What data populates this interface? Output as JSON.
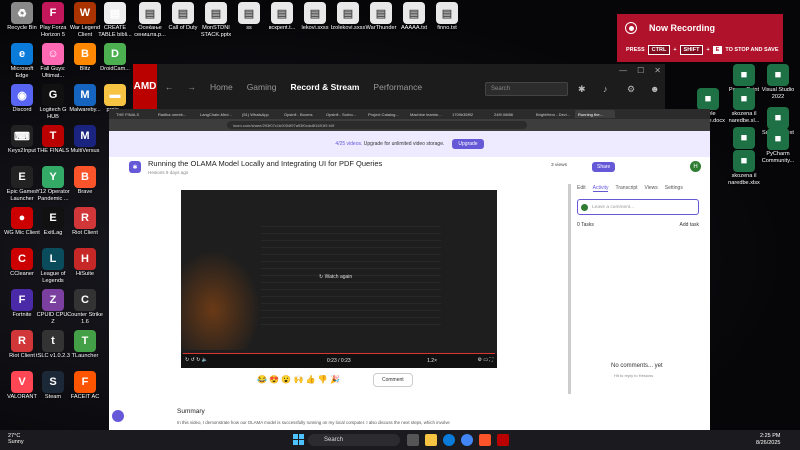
{
  "desktop_icons": [
    {
      "label": "Recycle Bin",
      "color": "#888",
      "glyph": "♻"
    },
    {
      "label": "Microsoft Edge",
      "color": "#0a7bd8",
      "glyph": "e"
    },
    {
      "label": "Discord",
      "color": "#5865f2",
      "glyph": "◉"
    },
    {
      "label": "Keys2Input",
      "color": "#222",
      "glyph": "⌨"
    },
    {
      "label": "Epic Games Launcher",
      "color": "#222",
      "glyph": "E"
    },
    {
      "label": "WG Mic Client",
      "color": "#c00",
      "glyph": "●"
    },
    {
      "label": "CCleaner",
      "color": "#c00",
      "glyph": "C"
    },
    {
      "label": "Fortnite",
      "color": "#4b2aa8",
      "glyph": "F"
    },
    {
      "label": "Riot Client",
      "color": "#d13639",
      "glyph": "R"
    },
    {
      "label": "VALORANT",
      "color": "#ff4655",
      "glyph": "V"
    },
    {
      "label": "Play Forza Horizon 5",
      "color": "#c2185b",
      "glyph": "F"
    },
    {
      "label": "Fall Guys: Ultimat...",
      "color": "#ff69b4",
      "glyph": "☺"
    },
    {
      "label": "Logitech G HUB",
      "color": "#111",
      "glyph": "G"
    },
    {
      "label": "THE FINALS",
      "color": "#b00",
      "glyph": "T"
    },
    {
      "label": "Y12 Operator Pandemic ...",
      "color": "#3a6",
      "glyph": "Y"
    },
    {
      "label": "ExitLag",
      "color": "#111",
      "glyph": "E"
    },
    {
      "label": "League of Legends",
      "color": "#0a4c5c",
      "glyph": "L"
    },
    {
      "label": "CPUID CPU-Z",
      "color": "#7b3fa0",
      "glyph": "Z"
    },
    {
      "label": "tSLC v1.0.2.3",
      "color": "#333",
      "glyph": "t"
    },
    {
      "label": "Steam",
      "color": "#1b2838",
      "glyph": "S"
    },
    {
      "label": "War Legend Client",
      "color": "#a30",
      "glyph": "W"
    },
    {
      "label": "Blitz",
      "color": "#f80",
      "glyph": "B"
    },
    {
      "label": "Malwareby...",
      "color": "#1565c0",
      "glyph": "M"
    },
    {
      "label": "MultiVersus",
      "color": "#1a237e",
      "glyph": "M"
    },
    {
      "label": "Brave",
      "color": "#fb542b",
      "glyph": "B"
    },
    {
      "label": "Riot Client",
      "color": "#d13639",
      "glyph": "R"
    },
    {
      "label": "HiSuite",
      "color": "#c62828",
      "glyph": "H"
    },
    {
      "label": "Counter Strike 1.6",
      "color": "#333",
      "glyph": "C"
    },
    {
      "label": "TLauncher",
      "color": "#43a047",
      "glyph": "T"
    },
    {
      "label": "FACEIT AC",
      "color": "#ff5500",
      "glyph": "F"
    },
    {
      "label": "CREATE TABLE bibli...",
      "color": "#eee",
      "glyph": "▤"
    },
    {
      "label": "DroidCam...",
      "color": "#4caf50",
      "glyph": "D"
    },
    {
      "label": "proje...",
      "color": "#f6c343",
      "glyph": "▬"
    }
  ],
  "top_files": [
    "Осеќање сеништа.р...",
    "Call of Duty",
    "MonSTDNI STACK.pptx",
    "ss",
    "вскрепt.t...",
    "lekovi.sxss",
    "Izolekovi.sxss",
    "WarThunder",
    "AAAAA.txt",
    "finno.txt"
  ],
  "right_icons": [
    "Power Point",
    "Visual Studio 2022",
    "Sublime Text",
    "PyCharm Community...",
    "ŠASM",
    "skozena il naredbe.sl...",
    "tabele naredbe.docx",
    "skozena il naredbe.xlsx"
  ],
  "recording": {
    "title": "Now Recording",
    "press": "PRESS",
    "ctrl": "CTRL",
    "plus1": "+",
    "shift": "SHIFT",
    "plus2": "+",
    "e": "E",
    "action": "TO STOP AND SAVE"
  },
  "amd": {
    "logo": "AMD",
    "nav": [
      "Home",
      "Gaming",
      "Record & Stream",
      "Performance"
    ],
    "active": "Record & Stream",
    "search_placeholder": "Search"
  },
  "browser": {
    "tabs": [
      "THE FINALS",
      "Radika umreb...",
      "LangChain-Med...",
      "(51) WhatsApp",
      "Opsinfi - Booms",
      "Opsinfi - Sorbo...",
      "Project Catalog...",
      "Machine learnin...",
      "1709b35f92",
      "24f9.06f88",
      "BrightHero - Devi...",
      "Running the..."
    ],
    "url": "loom.com/share/293f07c1b0054f97a93f0cdc8f1691f9 b0f",
    "banner_text": "4/25 videos.",
    "banner_rest": "Upgrade for unlimited video storage.",
    "upgrade": "Upgrade"
  },
  "loom": {
    "title": "Running the OLAMA Model Locally and Integrating UI for PDF Queries",
    "meta": "Hesions   9 days ago",
    "views": "3 views",
    "share": "Share",
    "avatar": "H",
    "watch_again": "Watch again",
    "time": "0:23 / 0:23",
    "speed": "1.2×",
    "reactions": "😂 😍 😮 🙌 👍 👎 🎉",
    "comment": "Comment",
    "summary_title": "Summary",
    "summary_text": "In this video, I demonstrate how our OLAMA model is successfully running on my local computer. I also discuss the next steps, which involve",
    "panel_tabs": [
      "Edit",
      "Activity",
      "Transcript",
      "Views",
      "Settings"
    ],
    "active_panel_tab": "Activity",
    "comment_placeholder": "Leave a comment...",
    "tasks": "0 Tasks",
    "add_task": "Add task",
    "no_comments": "No comments... yet",
    "no_comments_sub": "Hit  to reply to Hesions"
  },
  "taskbar": {
    "temp": "27°C",
    "weather": "Sunny",
    "search": "Search",
    "time": "2:25 PM",
    "date": "8/26/2025"
  }
}
